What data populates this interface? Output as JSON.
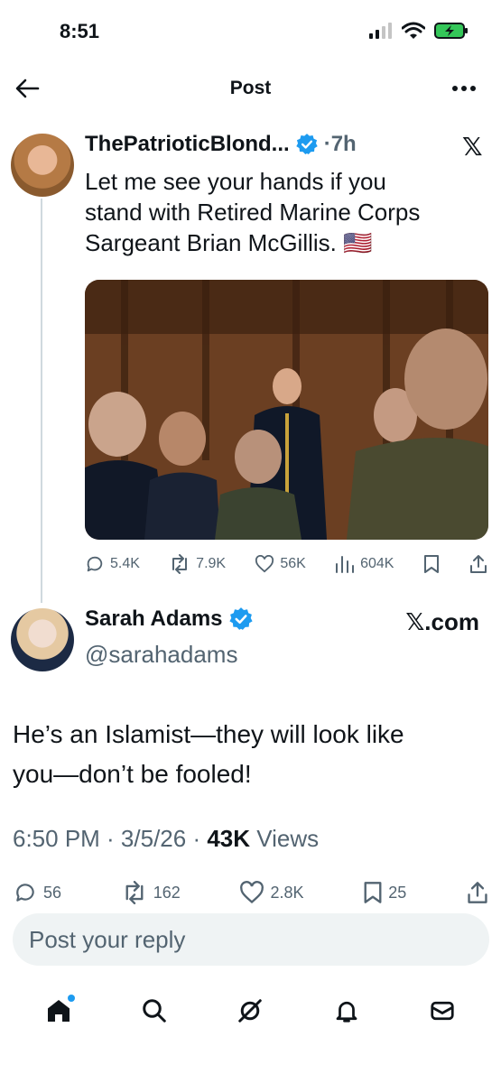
{
  "status_bar": {
    "time": "8:51"
  },
  "header": {
    "title": "Post"
  },
  "quoted_post": {
    "author_name": "ThePatrioticBlond...",
    "time": "7h",
    "text_lines": [
      "Let me see your hands if you",
      "stand with Retired Marine Corps",
      "Sargeant Brian McGillis."
    ],
    "flag": "🇺🇸",
    "stats": {
      "replies": "5.4K",
      "reposts": "7.9K",
      "likes": "56K",
      "views": "604K"
    }
  },
  "main_post": {
    "author_name": "Sarah Adams",
    "handle": "@sarahadams",
    "source": "𝕏.com",
    "text_lines": [
      "He’s an Islamist—they will look like",
      "you—don’t be fooled!"
    ],
    "timestamp": "6:50 PM · 3/5/26 · ",
    "views_count": "43K",
    "views_label": " Views",
    "stats": {
      "replies": "56",
      "reposts": "162",
      "likes": "2.8K",
      "bookmarks": "25"
    }
  },
  "reply": {
    "placeholder": "Post your reply"
  },
  "colors": {
    "verified": "#1d9bf0",
    "muted": "#536471",
    "border": "#cfd9de"
  }
}
